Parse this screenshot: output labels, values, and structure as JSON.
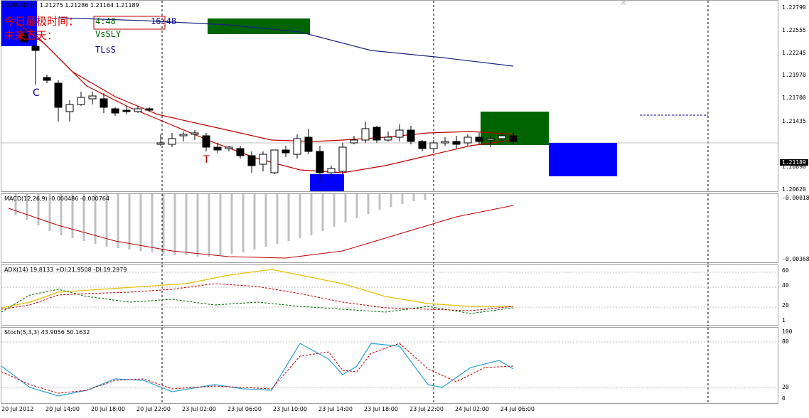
{
  "chart_header": "EURUSD,H1  1.21275 1.21286 1.21164 1.21189",
  "overlay": {
    "line1": "今日最极时间：",
    "line2": "未来五天：",
    "val_a": "4:48",
    "val_b": "16:48",
    "vssly": "VsSLY",
    "tlss": "TLsS",
    "marker_c": "C",
    "marker_t": "T"
  },
  "price_axis": [
    "1.22790",
    "1.22555",
    "1.22245",
    "1.21970",
    "1.21700",
    "1.21435",
    "1.21189",
    "1.20890",
    "1.20620"
  ],
  "current_price": "1.21189",
  "macd": {
    "label": "MACD(12,26,9) -0.000486 -0.000764",
    "axis_top": "-0.00018",
    "axis_bottom": "-0.003685"
  },
  "adx": {
    "label": "ADX(14) 19.8133 +DI:21.9508 -DI:19.2979",
    "axis": [
      "60",
      "40",
      "20",
      "1"
    ]
  },
  "stoch": {
    "label": "Stoch(5,3,3) 43.9056 50.1632",
    "axis": [
      "100",
      "80",
      "20",
      "0"
    ]
  },
  "time_axis": [
    "20 Jul 2012",
    "20 Jul 14:00",
    "20 Jul 18:00",
    "20 Jul 22:00",
    "23 Jul 02:00",
    "23 Jul 06:00",
    "23 Jul 10:00",
    "23 Jul 14:00",
    "23 Jul 18:00",
    "23 Jul 22:00",
    "24 Jul 02:00",
    "24 Jul 06:00"
  ],
  "colors": {
    "bull": "#ffffff",
    "bear": "#000000",
    "ma_red": "#c00000",
    "ma_blue": "#1a237e",
    "green_box": "#006400",
    "blue_box": "#0000ff",
    "hist": "#c0c0c0",
    "adx": "#e6c000",
    "di_plus": "#006400",
    "stoch_main": "#29a3d6",
    "stoch_sig": "#c00000"
  }
}
